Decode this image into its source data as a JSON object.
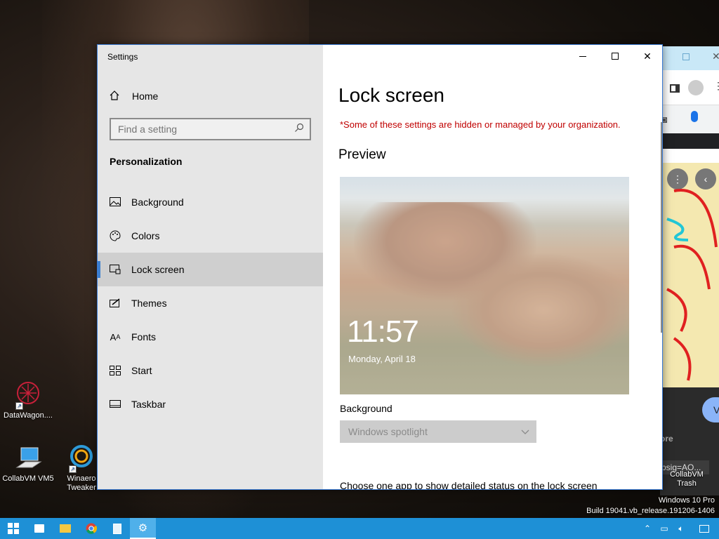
{
  "desktop": {
    "icons": [
      {
        "label": "DataWagon...."
      },
      {
        "label": "CollabVM VM5"
      },
      {
        "label": "Winaero Tweaker"
      }
    ],
    "trash_label": "CollabVM Trash",
    "watermark": {
      "line1": "Windows 10 Pro",
      "line2": "Build 19041.vb_release.191206-1406"
    }
  },
  "background_window": {
    "address_fragment": "psig=AO...",
    "side_text": "ore",
    "button_letter": "V"
  },
  "settings": {
    "app_title": "Settings",
    "home_label": "Home",
    "search_placeholder": "Find a setting",
    "section_heading": "Personalization",
    "nav_items": [
      {
        "label": "Background",
        "icon": "picture-icon"
      },
      {
        "label": "Colors",
        "icon": "palette-icon"
      },
      {
        "label": "Lock screen",
        "icon": "lock-screen-icon",
        "active": true
      },
      {
        "label": "Themes",
        "icon": "themes-icon"
      },
      {
        "label": "Fonts",
        "icon": "fonts-icon"
      },
      {
        "label": "Start",
        "icon": "start-icon"
      },
      {
        "label": "Taskbar",
        "icon": "taskbar-icon"
      }
    ],
    "page_title": "Lock screen",
    "warning": "*Some of these settings are hidden or managed by your organization.",
    "preview_heading": "Preview",
    "preview": {
      "time": "11:57",
      "date": "Monday, April 18"
    },
    "background_label": "Background",
    "background_value": "Windows spotlight",
    "detail_status_text": "Choose one app to show detailed status on the lock screen"
  },
  "colors": {
    "accent": "#3c7fd0",
    "warning": "#c00000",
    "taskbar": "#1e90d6"
  }
}
